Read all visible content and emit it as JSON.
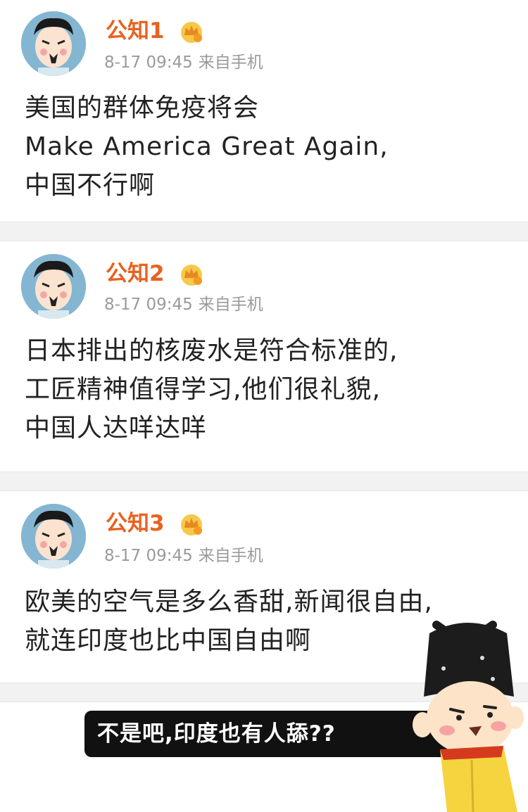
{
  "posts": [
    {
      "username": "公知1",
      "time": "8-17 09:45",
      "source": "来自手机",
      "lines": [
        "美国的群体免疫将会",
        "Make America Great Again,",
        "中国不行啊"
      ]
    },
    {
      "username": "公知2",
      "time": "8-17 09:45",
      "source": "来自手机",
      "lines": [
        "日本排出的核废水是符合标准的,",
        "工匠精神值得学习,他们很礼貌,",
        "中国人达咩达咩"
      ]
    },
    {
      "username": "公知3",
      "time": "8-17 09:45",
      "source": "来自手机",
      "lines": [
        "欧美的空气是多么香甜,新闻很自由,",
        "就连印度也比中国自由啊"
      ]
    }
  ],
  "caption": "不是吧,印度也有人舔??",
  "icons": {
    "avatar": "cartoon-avatar-icon",
    "vip": "crown-vip-icon",
    "sticker": "cartoon-character-sticker"
  },
  "colors": {
    "username": "#e8621f",
    "meta": "#9a9a9a",
    "separator": "#f2f2f2",
    "caption_bg": "#111111"
  }
}
